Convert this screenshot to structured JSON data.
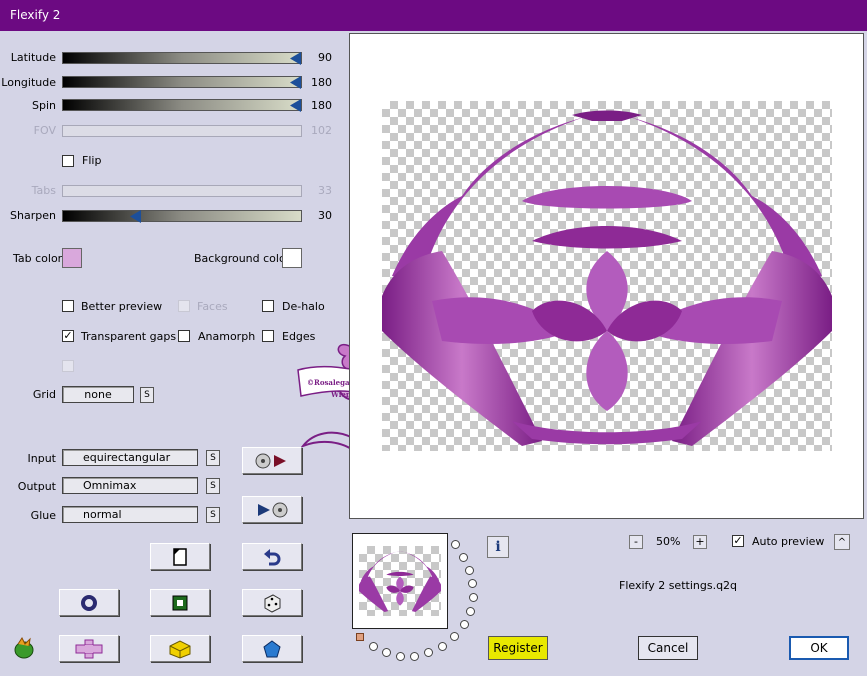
{
  "window": {
    "title": "Flexify 2"
  },
  "sliders": [
    {
      "label": "Latitude",
      "value": "90",
      "disabled": false,
      "level": 1.0
    },
    {
      "label": "Longitude",
      "value": "180",
      "disabled": false,
      "level": 1.0
    },
    {
      "label": "Spin",
      "value": "180",
      "disabled": false,
      "level": 1.0
    },
    {
      "label": "FOV",
      "value": "102",
      "disabled": true,
      "level": 0.0
    },
    {
      "label": "Tabs",
      "value": "33",
      "disabled": true,
      "level": 0.0
    },
    {
      "label": "Sharpen",
      "value": "30",
      "disabled": false,
      "level": 0.3
    }
  ],
  "flip": {
    "label": "Flip",
    "checked": false
  },
  "colors": {
    "tab_color_label": "Tab color",
    "tab_color": "#d9a8dc",
    "background_label": "Background color",
    "background_color": "#ffffff",
    "title_bar": "#6c0a82",
    "accent_purple": "#8e2a96"
  },
  "options": {
    "better_preview": {
      "label": "Better preview",
      "checked": false
    },
    "faces": {
      "label": "Faces",
      "checked": false,
      "disabled": true
    },
    "de_halo": {
      "label": "De-halo",
      "checked": false
    },
    "transparent_gaps": {
      "label": "Transparent gaps",
      "checked": true
    },
    "anamorph": {
      "label": "Anamorph",
      "checked": false
    },
    "edges": {
      "label": "Edges",
      "checked": false
    }
  },
  "grid": {
    "label": "Grid",
    "value": "none",
    "s": "S"
  },
  "input": {
    "label": "Input",
    "value": "equirectangular",
    "s": "S"
  },
  "output": {
    "label": "Output",
    "value": "Omnimax",
    "s": "S"
  },
  "glue": {
    "label": "Glue",
    "value": "normal",
    "s": "S"
  },
  "watermark": {
    "line1": "©Rosalegarten",
    "line2": "Wien"
  },
  "zoom": {
    "minus": "-",
    "value": "50%",
    "plus": "+"
  },
  "auto_preview": {
    "label": "Auto preview",
    "checked": true,
    "arrow": "^"
  },
  "settings_file": "Flexify 2 settings.q2q",
  "buttons": {
    "register": "Register",
    "cancel": "Cancel",
    "ok": "OK",
    "info": "i"
  },
  "icons": [
    "copy-icon",
    "undo-icon",
    "ring-icon",
    "square-icon",
    "dice-icon",
    "cross-icon",
    "cube-icon",
    "gem-icon",
    "plugin-logo-icon"
  ]
}
